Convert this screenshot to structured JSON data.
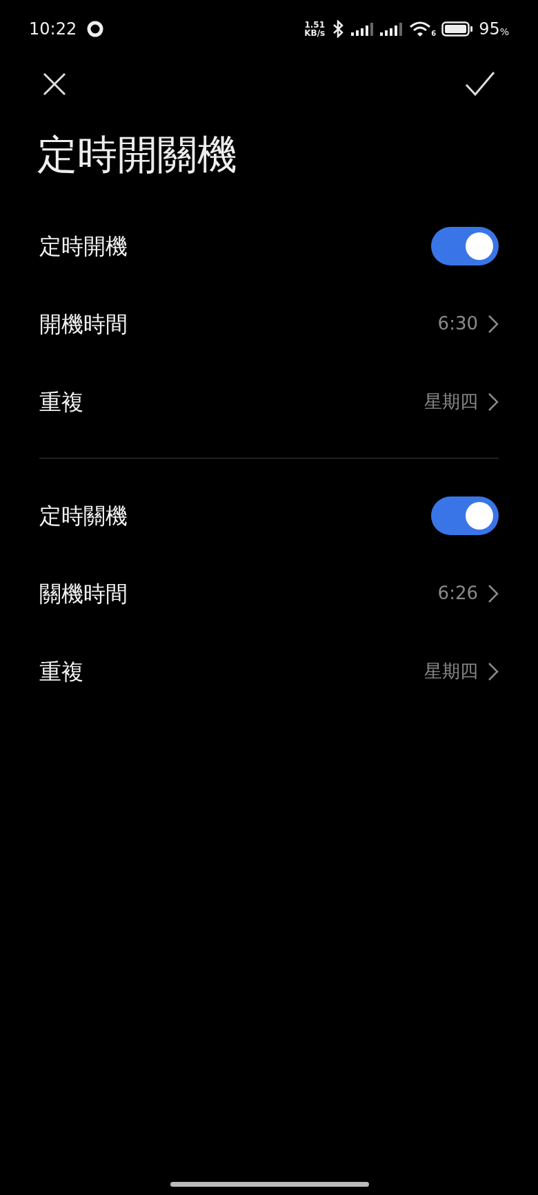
{
  "status_bar": {
    "time": "10:22",
    "speed_value": "1.51",
    "speed_unit": "KB/s",
    "wifi_standard": "6",
    "battery": "95",
    "battery_unit": "%"
  },
  "title": "定時開關機",
  "sections": [
    {
      "rows": [
        {
          "kind": "toggle",
          "label": "定時開機",
          "on": true
        },
        {
          "kind": "value",
          "label": "開機時間",
          "value": "6:30"
        },
        {
          "kind": "value",
          "label": "重複",
          "value": "星期四"
        }
      ]
    },
    {
      "rows": [
        {
          "kind": "toggle",
          "label": "定時關機",
          "on": true
        },
        {
          "kind": "value",
          "label": "關機時間",
          "value": "6:26"
        },
        {
          "kind": "value",
          "label": "重複",
          "value": "星期四"
        }
      ]
    }
  ]
}
